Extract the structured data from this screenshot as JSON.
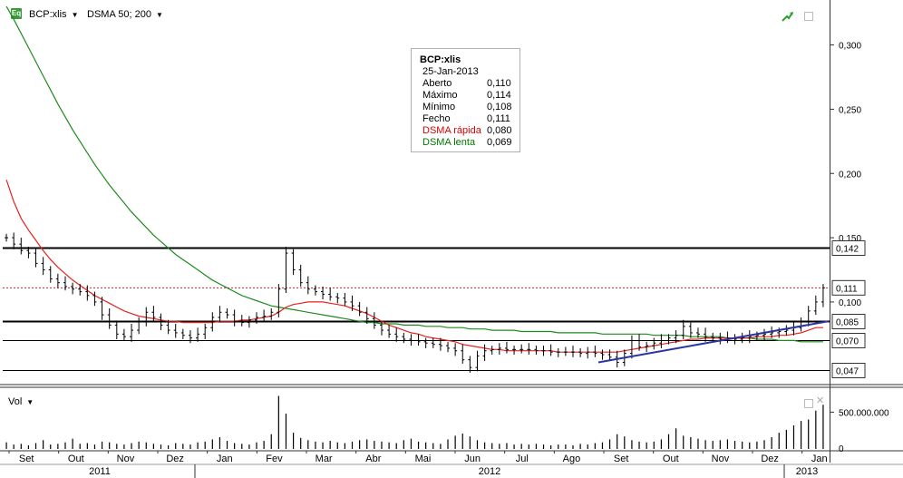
{
  "toolbar": {
    "eq_badge": "Eq",
    "symbol_label": "BCP:xlis",
    "indicator_label": "DSMA 50; 200"
  },
  "tooltip": {
    "title": "BCP:xlis",
    "date": "25-Jan-2013",
    "rows": [
      {
        "label": "Aberto",
        "value": "0,110",
        "color": "#000000"
      },
      {
        "label": "Máximo",
        "value": "0,114",
        "color": "#000000"
      },
      {
        "label": "Mínimo",
        "value": "0,108",
        "color": "#000000"
      },
      {
        "label": "Fecho",
        "value": "0,111",
        "color": "#000000"
      },
      {
        "label": "DSMA rápida",
        "value": "0,080",
        "color": "#dd0000"
      },
      {
        "label": "DSMA lenta",
        "value": "0,069",
        "color": "#007700"
      }
    ]
  },
  "volume_panel": {
    "label": "Vol",
    "axis_ticks": [
      "500.000.000",
      "0"
    ]
  },
  "colors": {
    "fast_sma": "#e8211e",
    "slow_sma": "#1f8a1f",
    "trendline": "#2a36a0",
    "price_bars": "#000000",
    "current_price_line": "#cc2222"
  },
  "icons": [
    "trend-arrow-icon",
    "maximize-icon",
    "close-icon"
  ],
  "chart_data": {
    "type": "ohlc",
    "price_axis_ticks": [
      "0,300",
      "0,250",
      "0,200",
      "0,150",
      "0,100"
    ],
    "price_axis_range": [
      0.035,
      0.335
    ],
    "horizontal_levels": [
      {
        "label": "0,142",
        "value": 0.142,
        "style": "heavy"
      },
      {
        "label": "0,085",
        "value": 0.085,
        "style": "heavy"
      },
      {
        "label": "0,070",
        "value": 0.07,
        "style": "thin"
      },
      {
        "label": "0,047",
        "value": 0.047,
        "style": "thin"
      }
    ],
    "last_price": {
      "label": "0,111",
      "value": 0.111
    },
    "x_months": [
      "Set",
      "Out",
      "Nov",
      "Dez",
      "Jan",
      "Fev",
      "Mar",
      "Abr",
      "Mai",
      "Jun",
      "Jul",
      "Ago",
      "Set",
      "Out",
      "Nov",
      "Dez",
      "Jan"
    ],
    "x_years": [
      "2011",
      "2012",
      "2013"
    ],
    "close": [
      0.15,
      0.145,
      0.14,
      0.138,
      0.13,
      0.125,
      0.118,
      0.115,
      0.112,
      0.11,
      0.108,
      0.105,
      0.1,
      0.09,
      0.082,
      0.075,
      0.073,
      0.078,
      0.085,
      0.092,
      0.088,
      0.082,
      0.078,
      0.076,
      0.074,
      0.072,
      0.075,
      0.08,
      0.088,
      0.092,
      0.09,
      0.085,
      0.084,
      0.086,
      0.088,
      0.089,
      0.092,
      0.11,
      0.138,
      0.125,
      0.115,
      0.11,
      0.108,
      0.106,
      0.104,
      0.103,
      0.1,
      0.097,
      0.092,
      0.087,
      0.082,
      0.078,
      0.075,
      0.073,
      0.071,
      0.07,
      0.069,
      0.068,
      0.067,
      0.066,
      0.064,
      0.062,
      0.055,
      0.049,
      0.058,
      0.062,
      0.063,
      0.064,
      0.063,
      0.063,
      0.063,
      0.063,
      0.062,
      0.062,
      0.061,
      0.061,
      0.061,
      0.061,
      0.06,
      0.061,
      0.06,
      0.059,
      0.057,
      0.053,
      0.06,
      0.07,
      0.065,
      0.066,
      0.068,
      0.07,
      0.072,
      0.074,
      0.081,
      0.076,
      0.075,
      0.073,
      0.072,
      0.071,
      0.072,
      0.071,
      0.072,
      0.073,
      0.074,
      0.075,
      0.076,
      0.077,
      0.078,
      0.08,
      0.085,
      0.093,
      0.1,
      0.111
    ],
    "fast_sma": [
      0.195,
      0.178,
      0.165,
      0.156,
      0.148,
      0.14,
      0.133,
      0.127,
      0.122,
      0.117,
      0.113,
      0.109,
      0.105,
      0.102,
      0.099,
      0.096,
      0.093,
      0.091,
      0.089,
      0.088,
      0.087,
      0.086,
      0.085,
      0.085,
      0.084,
      0.084,
      0.084,
      0.084,
      0.084,
      0.085,
      0.085,
      0.085,
      0.086,
      0.086,
      0.087,
      0.088,
      0.089,
      0.092,
      0.096,
      0.098,
      0.099,
      0.1,
      0.1,
      0.1,
      0.099,
      0.098,
      0.097,
      0.095,
      0.093,
      0.091,
      0.088,
      0.085,
      0.082,
      0.08,
      0.078,
      0.076,
      0.075,
      0.073,
      0.072,
      0.071,
      0.07,
      0.069,
      0.067,
      0.066,
      0.065,
      0.064,
      0.063,
      0.063,
      0.062,
      0.062,
      0.062,
      0.062,
      0.062,
      0.062,
      0.062,
      0.061,
      0.061,
      0.061,
      0.061,
      0.061,
      0.061,
      0.061,
      0.061,
      0.061,
      0.062,
      0.063,
      0.064,
      0.065,
      0.066,
      0.067,
      0.068,
      0.069,
      0.07,
      0.071,
      0.071,
      0.072,
      0.072,
      0.072,
      0.072,
      0.072,
      0.072,
      0.072,
      0.073,
      0.073,
      0.073,
      0.074,
      0.074,
      0.075,
      0.076,
      0.078,
      0.08,
      0.08
    ],
    "slow_sma": [
      0.33,
      0.32,
      0.309,
      0.298,
      0.287,
      0.276,
      0.265,
      0.254,
      0.244,
      0.234,
      0.225,
      0.216,
      0.207,
      0.199,
      0.191,
      0.184,
      0.177,
      0.17,
      0.164,
      0.158,
      0.152,
      0.147,
      0.142,
      0.137,
      0.133,
      0.129,
      0.125,
      0.121,
      0.117,
      0.114,
      0.111,
      0.108,
      0.105,
      0.103,
      0.101,
      0.099,
      0.097,
      0.096,
      0.095,
      0.094,
      0.093,
      0.092,
      0.091,
      0.09,
      0.089,
      0.088,
      0.087,
      0.086,
      0.085,
      0.084,
      0.084,
      0.083,
      0.083,
      0.083,
      0.082,
      0.082,
      0.082,
      0.081,
      0.081,
      0.081,
      0.08,
      0.08,
      0.08,
      0.079,
      0.079,
      0.079,
      0.078,
      0.078,
      0.078,
      0.078,
      0.077,
      0.077,
      0.077,
      0.077,
      0.077,
      0.076,
      0.076,
      0.076,
      0.076,
      0.076,
      0.076,
      0.075,
      0.075,
      0.075,
      0.075,
      0.075,
      0.075,
      0.075,
      0.074,
      0.074,
      0.074,
      0.074,
      0.074,
      0.073,
      0.073,
      0.073,
      0.073,
      0.073,
      0.072,
      0.072,
      0.072,
      0.072,
      0.071,
      0.071,
      0.071,
      0.07,
      0.07,
      0.07,
      0.069,
      0.069,
      0.069,
      0.069
    ],
    "trendline": {
      "from": 0.053,
      "to": 0.085
    },
    "volume_max": 800000000,
    "volume": [
      90,
      60,
      70,
      50,
      80,
      120,
      60,
      70,
      90,
      140,
      70,
      80,
      60,
      100,
      90,
      70,
      60,
      80,
      100,
      90,
      70,
      60,
      50,
      80,
      70,
      60,
      90,
      100,
      130,
      160,
      110,
      80,
      70,
      60,
      90,
      110,
      200,
      720,
      480,
      220,
      150,
      120,
      100,
      90,
      110,
      90,
      80,
      100,
      120,
      130,
      110,
      100,
      90,
      80,
      120,
      140,
      100,
      90,
      80,
      70,
      130,
      180,
      210,
      170,
      120,
      90,
      80,
      70,
      80,
      60,
      70,
      60,
      70,
      60,
      50,
      60,
      60,
      50,
      70,
      60,
      80,
      90,
      130,
      200,
      170,
      120,
      100,
      90,
      100,
      130,
      200,
      280,
      180,
      160,
      140,
      120,
      110,
      120,
      130,
      110,
      100,
      90,
      100,
      120,
      160,
      220,
      260,
      320,
      380,
      400,
      520,
      600
    ]
  }
}
